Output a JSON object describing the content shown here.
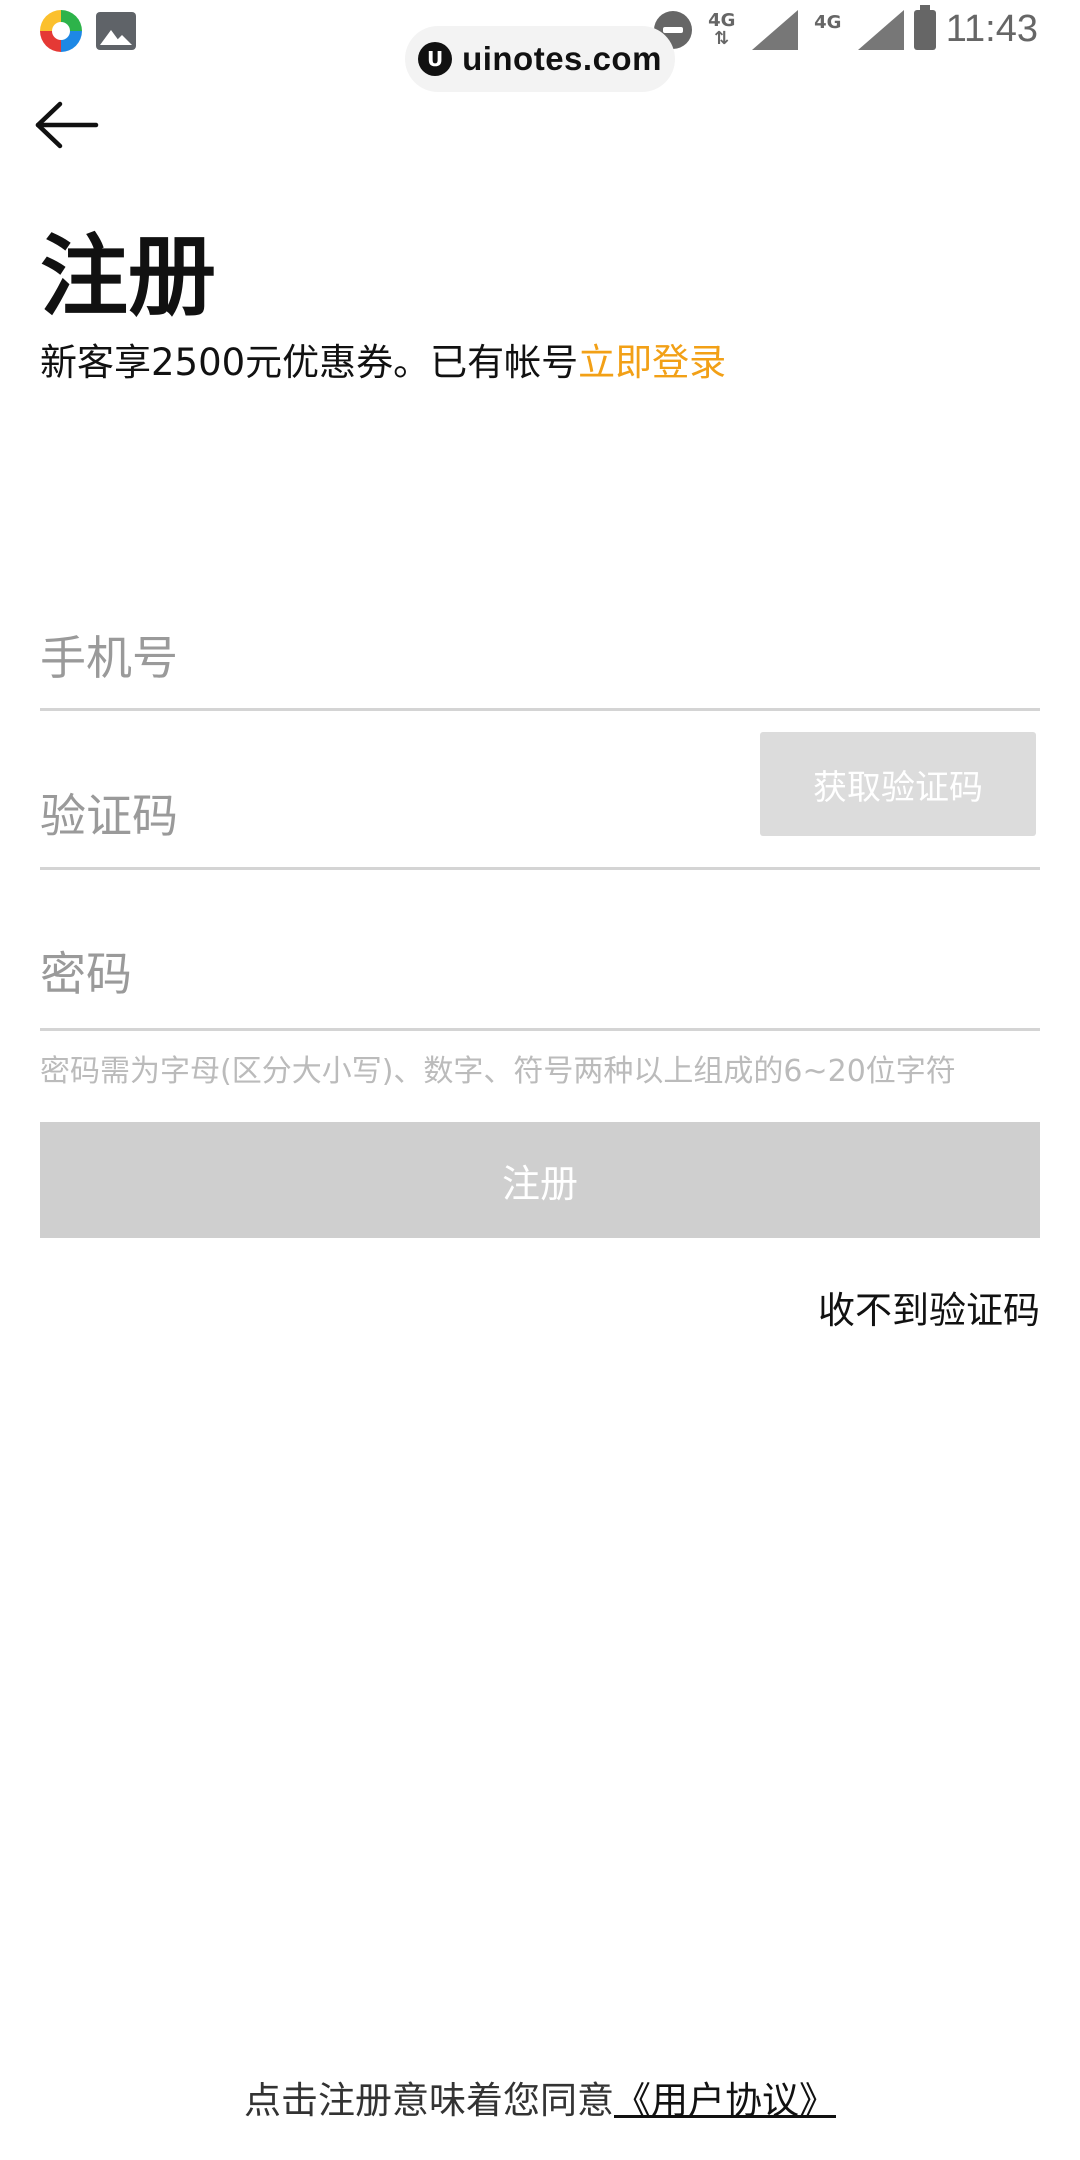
{
  "status_bar": {
    "time": "11:43",
    "network_1": "4G",
    "network_2": "4G"
  },
  "watermark": {
    "logo_letter": "U",
    "text": "uinotes.com"
  },
  "header": {
    "title": "注册",
    "subtitle": "新客享2500元优惠券。已有帐号",
    "login_link": "立即登录"
  },
  "form": {
    "phone_placeholder": "手机号",
    "code_placeholder": "验证码",
    "get_code_label": "获取验证码",
    "password_placeholder": "密码",
    "password_hint": "密码需为字母(区分大小写)、数字、符号两种以上组成的6~20位字符",
    "register_label": "注册",
    "no_code_label": "收不到验证码"
  },
  "footer": {
    "agreement_text": "点击注册意味着您同意",
    "agreement_link": "《用户协议》"
  },
  "colors": {
    "accent": "#f2a016",
    "disabled_button": "#cfcfcf",
    "placeholder": "#9a9a9a"
  }
}
